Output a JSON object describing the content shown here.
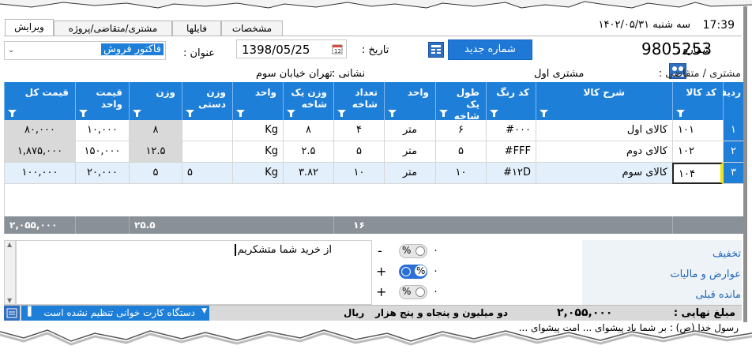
{
  "top": {
    "clock": "17:39",
    "date": "سه شنبه ۱۴۰۲/۰۵/۳۱",
    "tabs": [
      "ویرایش",
      "مشتری/متقاضی/پروژه",
      "فایلها",
      "مشخصات"
    ]
  },
  "header": {
    "number_label": "شماره :",
    "number_value": "9805253",
    "new_number_button": "شماره جدید",
    "date_label": "تاریخ :",
    "date_value": "1398/05/25",
    "title_label": "عنوان :",
    "title_value": "فاکتور فروش",
    "customer_label": "مشتری / متقاضی :",
    "customer_value": "مشتری اول",
    "address_label": "نشانی :",
    "address_value": "تهران خیابان سوم"
  },
  "grid": {
    "columns": [
      "ردیف",
      "کد کالا",
      "شرح کالا",
      "کد رنگ",
      "طول یک شاخه",
      "واحد",
      "تعداد شاخه",
      "وزن یک شاخه",
      "واحد",
      "وزن دستی",
      "وزن",
      "قیمت واحد",
      "قیمت کل"
    ],
    "rows": [
      [
        "۱",
        "۱۰۱",
        "کالای اول",
        "#۰۰۰",
        "۶",
        "متر",
        "۴",
        "۸",
        "Kg",
        "",
        "۸",
        "۱۰,۰۰۰",
        "۸۰,۰۰۰"
      ],
      [
        "۲",
        "۱۰۲",
        "کالای دوم",
        "#FFF",
        "۵",
        "متر",
        "۵",
        "۲.۵",
        "Kg",
        "",
        "۱۲.۵",
        "۱۵۰,۰۰۰",
        "۱,۸۷۵,۰۰۰"
      ],
      [
        "۳",
        "۱۰۴",
        "کالای سوم",
        "#۱۲D",
        "۱۰",
        "متر",
        "۱۰",
        "۳.۸۲",
        "Kg",
        "۵",
        "۵",
        "۲۰,۰۰۰",
        "۱۰۰,۰۰۰"
      ]
    ],
    "totals": {
      "count": "۱۶",
      "weight": "۲۵.۵",
      "total": "۲,۰۵۵,۰۰۰"
    }
  },
  "footer": {
    "note_text": "از خرید شما متشکریم",
    "adjustments": [
      {
        "label": "تخفیف",
        "value": "۰",
        "sign": "-",
        "percent": "%"
      },
      {
        "label": "عوارض و مالیات",
        "value": "۰",
        "sign": "+",
        "percent": "%"
      },
      {
        "label": "مانده قبلی",
        "value": "۰",
        "sign": "+",
        "percent": "%"
      }
    ],
    "final_label": "مبلغ نهایی :",
    "final_value": "۲,۰۵۵,۰۰۰",
    "amount_words": "دو میلیون و پنجاه و پنج هزار",
    "currency": "ریال",
    "card_reader": "دستگاه کارت خوانی تنظیم نشده است",
    "bottom_text": "رسول خدا (ص) : بر شما باد پیشوای ... امت پیشوای ..."
  }
}
